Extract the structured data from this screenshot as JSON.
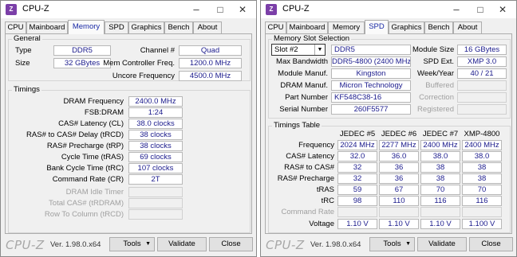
{
  "left": {
    "title": "CPU-Z",
    "tabs": [
      "CPU",
      "Mainboard",
      "Memory",
      "SPD",
      "Graphics",
      "Bench",
      "About"
    ],
    "general": {
      "title": "General",
      "type_label": "Type",
      "type_value": "DDR5",
      "size_label": "Size",
      "size_value": "32 GBytes",
      "channel_label": "Channel #",
      "channel_value": "Quad",
      "memctrl_label": "Mem Controller Freq.",
      "memctrl_value": "1200.0 MHz",
      "uncore_label": "Uncore Frequency",
      "uncore_value": "4500.0 MHz"
    },
    "timings": {
      "title": "Timings",
      "rows": [
        {
          "label": "DRAM Frequency",
          "value": "2400.0 MHz"
        },
        {
          "label": "FSB:DRAM",
          "value": "1:24"
        },
        {
          "label": "CAS# Latency (CL)",
          "value": "38.0 clocks"
        },
        {
          "label": "RAS# to CAS# Delay (tRCD)",
          "value": "38 clocks"
        },
        {
          "label": "RAS# Precharge (tRP)",
          "value": "38 clocks"
        },
        {
          "label": "Cycle Time (tRAS)",
          "value": "69 clocks"
        },
        {
          "label": "Bank Cycle Time (tRC)",
          "value": "107 clocks"
        },
        {
          "label": "Command Rate (CR)",
          "value": "2T"
        },
        {
          "label": "DRAM Idle Timer",
          "value": ""
        },
        {
          "label": "Total CAS# (tRDRAM)",
          "value": ""
        },
        {
          "label": "Row To Column (tRCD)",
          "value": ""
        }
      ]
    },
    "footer": {
      "logo": "CPU-Z",
      "version": "Ver. 1.98.0.x64",
      "tools": "Tools",
      "validate": "Validate",
      "close": "Close"
    }
  },
  "right": {
    "title": "CPU-Z",
    "tabs": [
      "CPU",
      "Mainboard",
      "Memory",
      "SPD",
      "Graphics",
      "Bench",
      "About"
    ],
    "slot": {
      "title": "Memory Slot Selection",
      "slot_value": "Slot #2",
      "type_value": "DDR5",
      "module_size_label": "Module Size",
      "module_size_value": "16 GBytes",
      "max_bw_label": "Max Bandwidth",
      "max_bw_value": "DDR5-4800 (2400 MHz)",
      "spd_ext_label": "SPD Ext.",
      "spd_ext_value": "XMP 3.0",
      "manuf_label": "Module Manuf.",
      "manuf_value": "Kingston",
      "week_label": "Week/Year",
      "week_value": "40 / 21",
      "dram_manuf_label": "DRAM Manuf.",
      "dram_manuf_value": "Micron Technology",
      "buffered_label": "Buffered",
      "part_label": "Part Number",
      "part_value": "KF548C38-16",
      "correction_label": "Correction",
      "serial_label": "Serial Number",
      "serial_value": "260F5577",
      "registered_label": "Registered"
    },
    "timings_table": {
      "title": "Timings Table",
      "columns": [
        "JEDEC #5",
        "JEDEC #6",
        "JEDEC #7",
        "XMP-4800"
      ],
      "rows": [
        {
          "label": "Frequency",
          "values": [
            "2024 MHz",
            "2277 MHz",
            "2400 MHz",
            "2400 MHz"
          ]
        },
        {
          "label": "CAS# Latency",
          "values": [
            "32.0",
            "36.0",
            "38.0",
            "38.0"
          ]
        },
        {
          "label": "RAS# to CAS#",
          "values": [
            "32",
            "36",
            "38",
            "38"
          ]
        },
        {
          "label": "RAS# Precharge",
          "values": [
            "32",
            "36",
            "38",
            "38"
          ]
        },
        {
          "label": "tRAS",
          "values": [
            "59",
            "67",
            "70",
            "70"
          ]
        },
        {
          "label": "tRC",
          "values": [
            "98",
            "110",
            "116",
            "116"
          ]
        },
        {
          "label": "Command Rate",
          "values": [
            "",
            "",
            "",
            ""
          ]
        },
        {
          "label": "Voltage",
          "values": [
            "1.10 V",
            "1.10 V",
            "1.10 V",
            "1.100 V"
          ]
        }
      ]
    },
    "footer": {
      "logo": "CPU-Z",
      "version": "Ver. 1.98.0.x64",
      "tools": "Tools",
      "validate": "Validate",
      "close": "Close"
    }
  }
}
